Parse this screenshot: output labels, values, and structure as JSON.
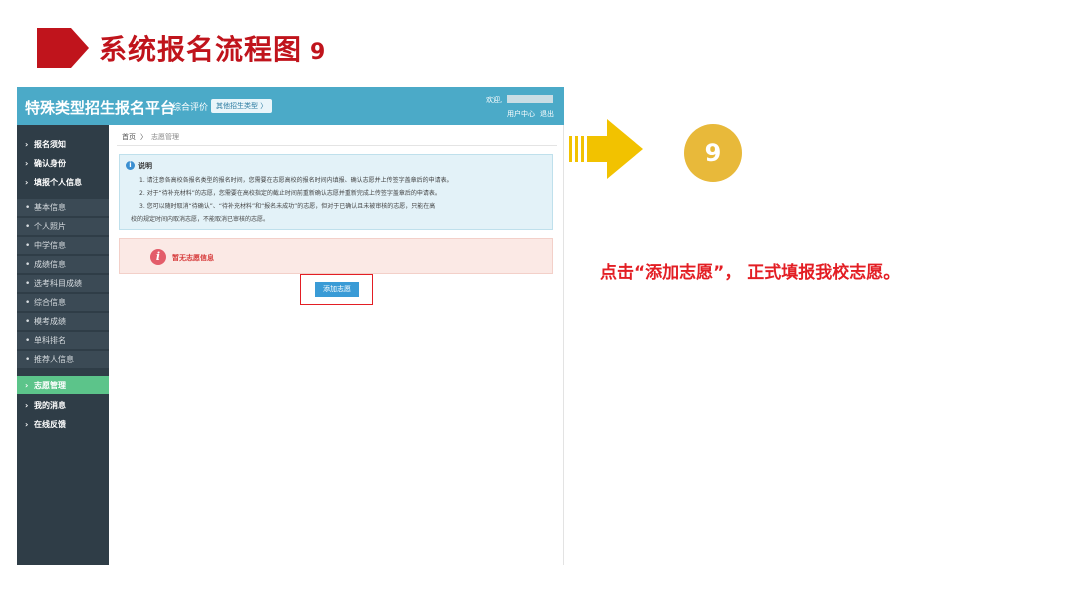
{
  "slide": {
    "title": "系统报名流程图",
    "step_number": "9",
    "step_badge": "9",
    "instruction": "点击“添加志愿”， 正式填报我校志愿。",
    "accent_color": "#c0141c",
    "arrow_color": "#f2c200"
  },
  "app": {
    "brand": "特殊类型招生报名平台",
    "nav_label": "综合评价",
    "nav_badge": "其他招生类型 〉",
    "welcome": "欢迎,",
    "user_center": "用户中心",
    "logout": "退出",
    "topbar_color": "#4baac8"
  },
  "sidebar": {
    "items": [
      {
        "label": "报名须知"
      },
      {
        "label": "确认身份"
      },
      {
        "label": "填报个人信息"
      }
    ],
    "sub_items": [
      {
        "label": "基本信息"
      },
      {
        "label": "个人照片"
      },
      {
        "label": "中学信息"
      },
      {
        "label": "成绩信息"
      },
      {
        "label": "选考科目成绩"
      },
      {
        "label": "综合信息"
      },
      {
        "label": "模考成绩"
      },
      {
        "label": "单科排名"
      },
      {
        "label": "推荐人信息"
      }
    ],
    "bottom_items": [
      {
        "label": "志愿管理",
        "active": true
      },
      {
        "label": "我的消息"
      },
      {
        "label": "在线反馈"
      }
    ]
  },
  "breadcrumb": {
    "home": "首页",
    "separator": "〉",
    "current": "志愿管理"
  },
  "notice": {
    "title": "说明",
    "lines": [
      "1. 请注意各高校各报名类型的报名时间，您需要在志愿高校的报名时间内填报、确认志愿并上传签字盖章后的申请表。",
      "2. 对于“待补充材料”的志愿，您需要在高校指定的截止时间前重新确认志愿并重新完成上传签字盖章后的申请表。",
      "3. 您可以随时取消“待确认”、“待补充材料”和“报名未成功”的志愿，但对于已确认且未被审核的志愿，只能在高",
      "校的规定时间内取消志愿，不能取消已审核的志愿。"
    ]
  },
  "alert": {
    "text": "暂无志愿信息"
  },
  "actions": {
    "add_label": "添加志愿"
  }
}
